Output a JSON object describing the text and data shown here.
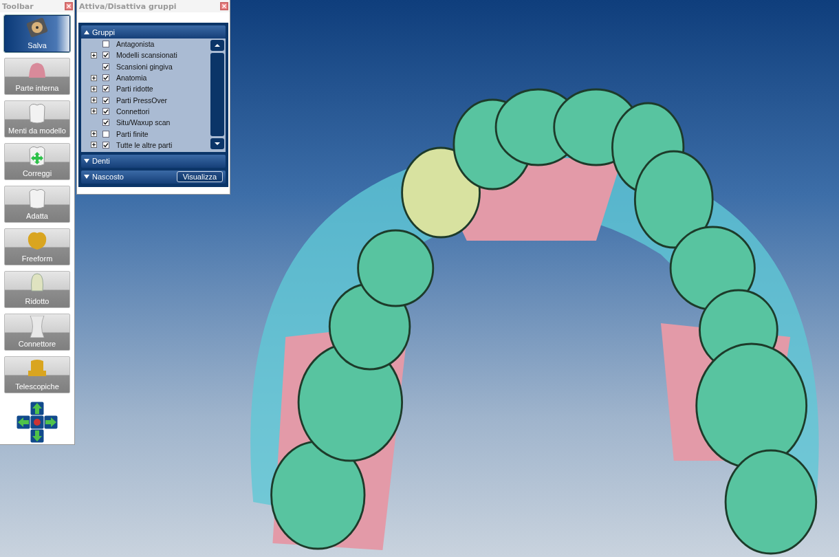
{
  "toolbar": {
    "title": "Toolbar",
    "buttons": [
      {
        "label": "Salva",
        "kind": "disk",
        "selected": true
      },
      {
        "label": "Parte interna",
        "kind": "coping",
        "selected": false
      },
      {
        "label": "Menti da modello",
        "kind": "tooth",
        "selected": false
      },
      {
        "label": "Correggi",
        "kind": "move",
        "selected": false
      },
      {
        "label": "Adatta",
        "kind": "tooth",
        "selected": false
      },
      {
        "label": "Freeform",
        "kind": "gold",
        "selected": false
      },
      {
        "label": "Ridotto",
        "kind": "reduced",
        "selected": false
      },
      {
        "label": "Connettore",
        "kind": "connector",
        "selected": false
      },
      {
        "label": "Telescopiche",
        "kind": "telescope",
        "selected": false
      }
    ]
  },
  "groups_window": {
    "title": "Attiva/Disattiva gruppi",
    "sections": [
      {
        "title": "Gruppi",
        "expanded": true,
        "items": [
          {
            "label": "Antagonista",
            "checked": false,
            "expandable": false
          },
          {
            "label": "Modelli scansionati",
            "checked": true,
            "expandable": true
          },
          {
            "label": "Scansioni gingiva",
            "checked": true,
            "expandable": false
          },
          {
            "label": "Anatomia",
            "checked": true,
            "expandable": true
          },
          {
            "label": "Parti ridotte",
            "checked": true,
            "expandable": true
          },
          {
            "label": "Parti PressOver",
            "checked": true,
            "expandable": true
          },
          {
            "label": "Connettori",
            "checked": true,
            "expandable": true
          },
          {
            "label": "Situ/Waxup scan",
            "checked": true,
            "expandable": false
          },
          {
            "label": "Parti finite",
            "checked": false,
            "expandable": true
          },
          {
            "label": "Tutte le altre parti",
            "checked": true,
            "expandable": true
          }
        ]
      },
      {
        "title": "Denti",
        "expanded": false
      },
      {
        "title": "Nascosto",
        "expanded": false,
        "button": "Visualizza"
      }
    ]
  }
}
